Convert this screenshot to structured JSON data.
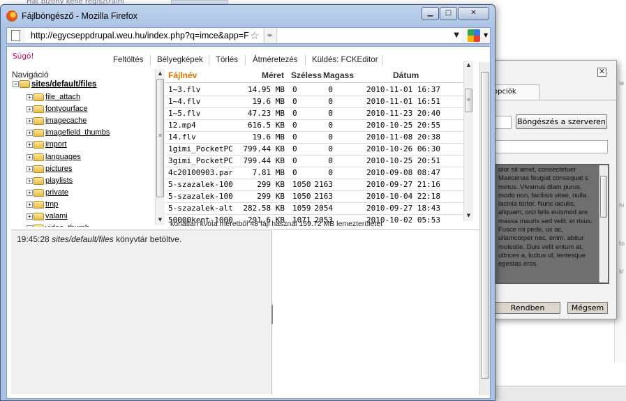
{
  "background": {
    "top_link": "Hát bizony kéne regisztrálni",
    "right_texts": [
      "le",
      "hi",
      "to",
      "kl"
    ]
  },
  "dialog": {
    "tab_label": "opciók",
    "browse_button": "Böngészés a szerveren",
    "preview_text": "olor sit amet, consectetuer Maecenas feugiat consequat s metus. Vivamus diam purus, modo non, facilisis vitae, nulla. lacinia tortor. Nunc iaculis, aliquam, orci felis euismod are massa mauris sed velit. et risus. Fusce mi pede, us ac, ullamcorper nec, enim. abitur molestie. Duis velit entum at, ultrices a, luctus ut, lentesque egestas eros.",
    "ok_button": "Rendben",
    "cancel_button": "Mégsem"
  },
  "window": {
    "title": "Fájlböngésző - Mozilla Firefox",
    "url": "http://egycseppdrupal.weu.hu/index.php?q=imce&app=F"
  },
  "imce": {
    "help": "Súgó!",
    "ops": [
      "Feltöltés",
      "Bélyegképek",
      "Törlés",
      "Átméretezés",
      "Küldés: FCKEditor"
    ],
    "nav_heading": "Navigáció",
    "tree_root": "sites/default/files",
    "folders": [
      "file_attach",
      "fontyourface",
      "imagecache",
      "imagefield_thumbs",
      "import",
      "languages",
      "pictures",
      "playlists",
      "private",
      "tmp",
      "valami",
      "video_thumb"
    ],
    "columns": {
      "name": "Fájlnév",
      "size": "Méret",
      "width": "Széless",
      "height": "Magass",
      "date": "Dátum"
    },
    "files": [
      {
        "name": "1~3.flv",
        "size": "14.95 MB",
        "w": "0",
        "h": "0",
        "date": "2010-11-01 16:37"
      },
      {
        "name": "1~4.flv",
        "size": "19.6 MB",
        "w": "0",
        "h": "0",
        "date": "2010-11-01 16:51"
      },
      {
        "name": "1~5.flv",
        "size": "47.23 MB",
        "w": "0",
        "h": "0",
        "date": "2010-11-23 20:40"
      },
      {
        "name": "12.mp4",
        "size": "616.5 KB",
        "w": "0",
        "h": "0",
        "date": "2010-10-25 20:55"
      },
      {
        "name": "14.flv",
        "size": "19.6 MB",
        "w": "0",
        "h": "0",
        "date": "2010-11-08 20:38"
      },
      {
        "name": "1gimi_PocketPC",
        "size": "799.44 KB",
        "w": "0",
        "h": "0",
        "date": "2010-10-26 06:30"
      },
      {
        "name": "3gimi_PocketPC",
        "size": "799.44 KB",
        "w": "0",
        "h": "0",
        "date": "2010-10-25 20:51"
      },
      {
        "name": "4c20100903.par",
        "size": "7.81 MB",
        "w": "0",
        "h": "0",
        "date": "2010-09-08 08:47"
      },
      {
        "name": "5-szazalek-1000",
        "size": "299 KB",
        "w": "1050",
        "h": "2163",
        "date": "2010-09-27 21:16"
      },
      {
        "name": "5-szazalek-1000",
        "size": "299 KB",
        "w": "1050",
        "h": "2163",
        "date": "2010-10-04 22:18"
      },
      {
        "name": "5-szazalek-altal",
        "size": "282.58 KB",
        "w": "1059",
        "h": "2054",
        "date": "2010-09-27 18:43"
      },
      {
        "name": "50000kent-1000",
        "size": "291.6 KB",
        "w": "1071",
        "h": "2053",
        "date": "2010-10-02 05:53"
      }
    ],
    "quota": "korlátlan kvóta méretből 48 fájl használ 159.72 MB lemezterületet",
    "log_time": "19:45:28",
    "log_path": "sites/default/files",
    "log_message": "könyvtár betöltve."
  }
}
